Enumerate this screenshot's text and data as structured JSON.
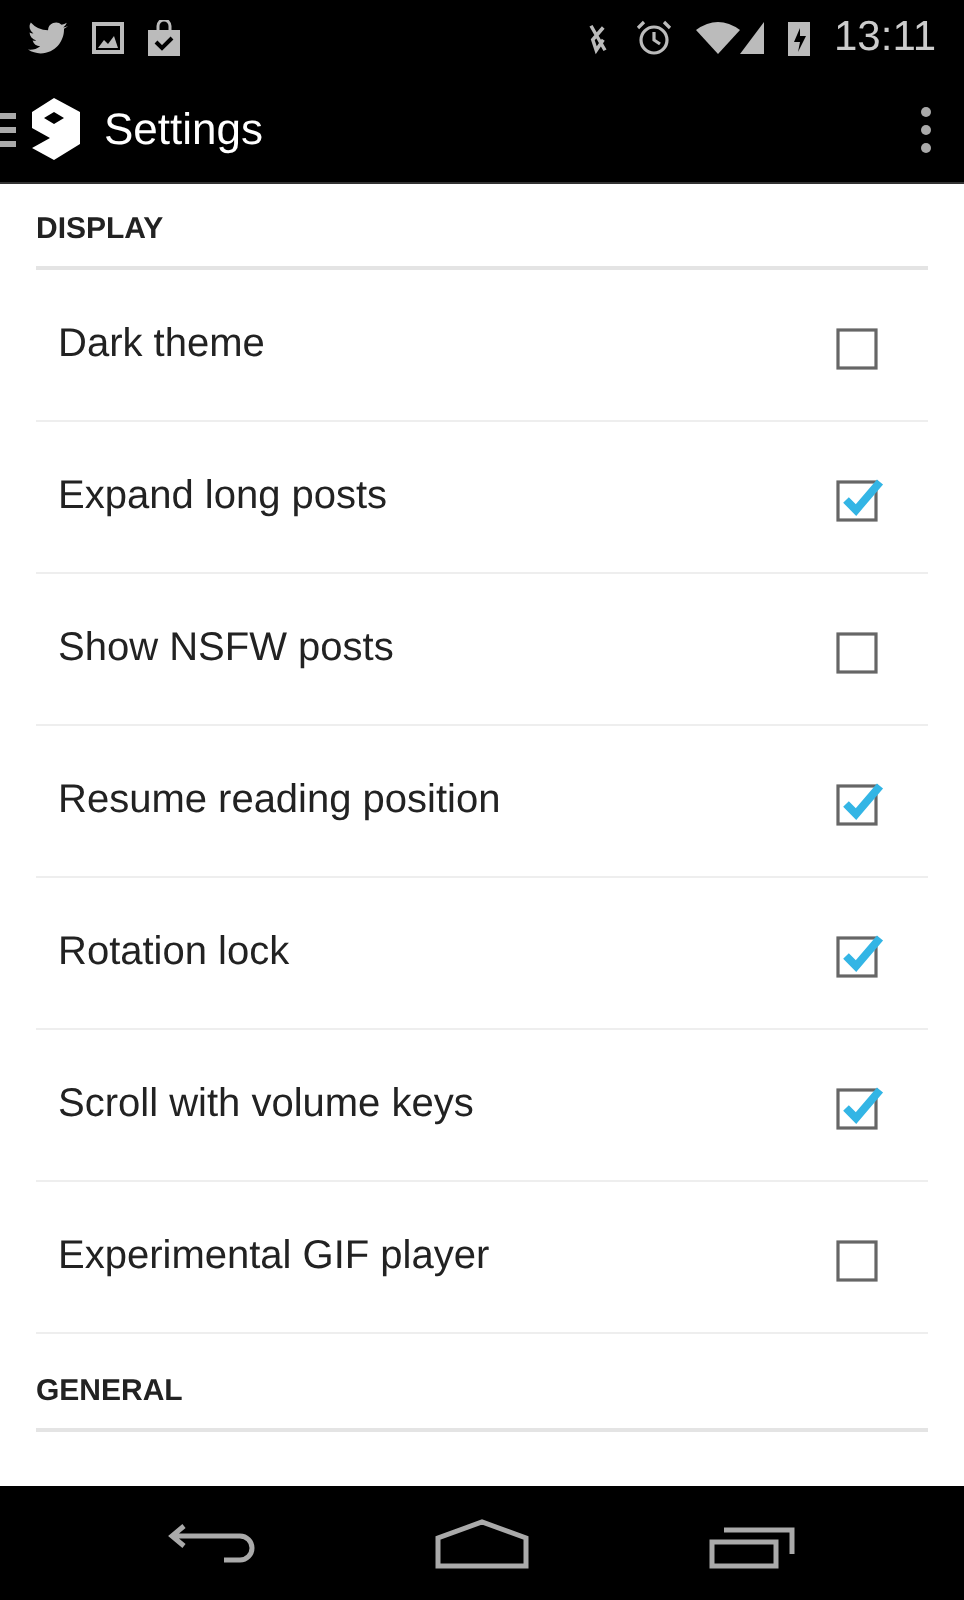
{
  "status_bar": {
    "time": "13:11"
  },
  "action_bar": {
    "title": "Settings"
  },
  "sections": [
    {
      "header": "DISPLAY",
      "items": [
        {
          "label": "Dark theme",
          "checked": false
        },
        {
          "label": "Expand long posts",
          "checked": true
        },
        {
          "label": "Show NSFW posts",
          "checked": false
        },
        {
          "label": "Resume reading position",
          "checked": true
        },
        {
          "label": "Rotation lock",
          "checked": true
        },
        {
          "label": "Scroll with volume keys",
          "checked": true
        },
        {
          "label": "Experimental GIF player",
          "checked": false
        }
      ]
    },
    {
      "header": "GENERAL"
    }
  ]
}
